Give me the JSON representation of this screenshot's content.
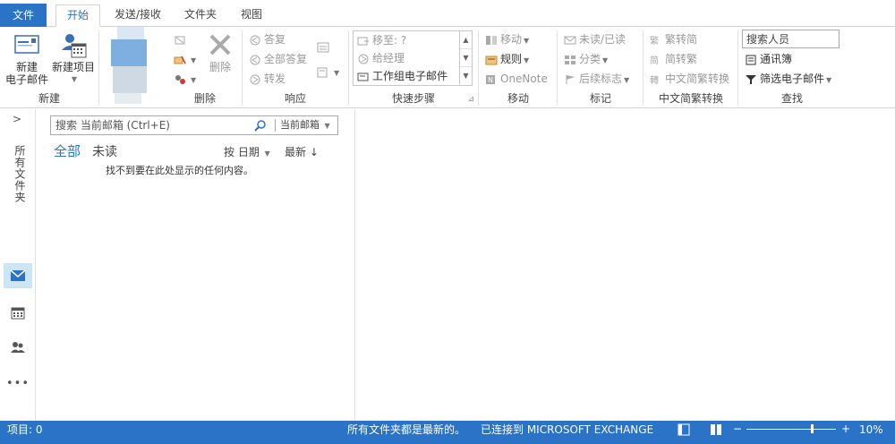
{
  "tabs": {
    "file": "文件",
    "home": "开始",
    "send_receive": "发送/接收",
    "folder": "文件夹",
    "view": "视图"
  },
  "ribbon": {
    "new_group": {
      "label": "新建",
      "new_email_line1": "新建",
      "new_email_line2": "电子邮件",
      "new_items": "新建项目"
    },
    "delete_group": {
      "label": "删除",
      "delete": "删除"
    },
    "respond_group": {
      "label": "响应",
      "reply": "答复",
      "reply_all": "全部答复",
      "forward": "转发"
    },
    "quick_steps_group": {
      "label": "快速步骤",
      "items": [
        "移至: ?",
        "给经理",
        "工作组电子邮件"
      ]
    },
    "move_group": {
      "label": "移动",
      "move": "移动",
      "rules": "规则",
      "onenote": "OneNote"
    },
    "tags_group": {
      "label": "标记",
      "unread_read": "未读/已读",
      "categorize": "分类",
      "follow_up": "后续标志"
    },
    "chinese_conv_group": {
      "label": "中文简繁转换",
      "to_traditional": "繁转简",
      "to_simplified": "简转繁",
      "convert": "中文简繁转换"
    },
    "find_group": {
      "label": "查找",
      "search_people": "搜索人员",
      "address_book": "通讯簿",
      "filter_email": "筛选电子邮件"
    }
  },
  "nav": {
    "all_folders": "所有文件夹",
    "more": "•••"
  },
  "mail_list": {
    "search_placeholder": "搜索 当前邮箱 (Ctrl+E)",
    "scope": "当前邮箱",
    "filter_all": "全部",
    "filter_unread": "未读",
    "sort_by": "按 日期",
    "sort_order": "最新 ↓",
    "empty_message": "找不到要在此处显示的任何内容。"
  },
  "status": {
    "items": "项目: 0",
    "folders_up_to_date": "所有文件夹都是最新的。",
    "connected": "已连接到 MICROSOFT EXCHANGE",
    "zoom": "10%"
  },
  "colors": {
    "accent": "#2b73c6"
  }
}
